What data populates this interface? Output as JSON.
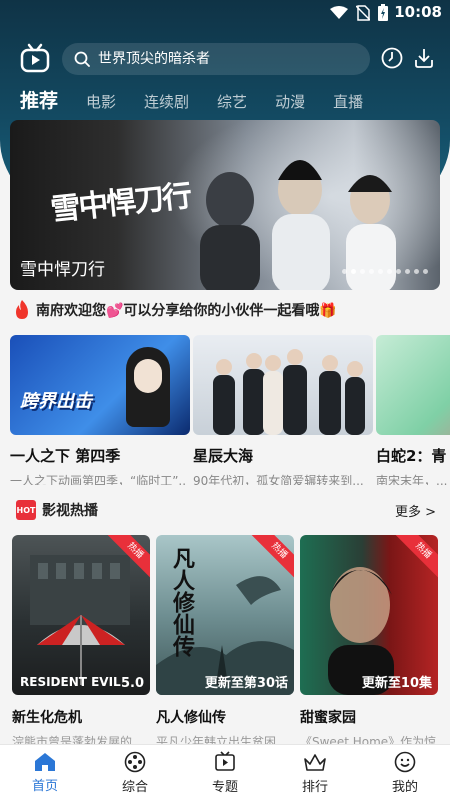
{
  "status": {
    "time": "10:08"
  },
  "search": {
    "placeholder": "世界顶尖的暗杀者"
  },
  "tabs": [
    {
      "label": "推荐",
      "active": true
    },
    {
      "label": "电影"
    },
    {
      "label": "连续剧"
    },
    {
      "label": "综艺"
    },
    {
      "label": "动漫"
    },
    {
      "label": "直播"
    }
  ],
  "banner": {
    "caption": "雪中悍刀行",
    "calligraphy": "雪中悍刀行",
    "dots": 10,
    "active_dot": 1
  },
  "notice": {
    "text": "南府欢迎您💕可以分享给你的小伙伴一起看哦🎁"
  },
  "featured": [
    {
      "title": "一人之下 第四季",
      "desc": "一人之下动画第四季，“临时工”..."
    },
    {
      "title": "星辰大海",
      "desc": "90年代初，孤女简爱辗转来到..."
    },
    {
      "title": "白蛇2：青",
      "desc": "南宋末年，..."
    }
  ],
  "hot_section": {
    "badge": "HOT",
    "label": "影视热播",
    "more": "更多 >"
  },
  "hot_items": [
    {
      "title": "新生化危机",
      "desc": "浣熊市曾是蓬勃发展的...",
      "overlay": "5.0",
      "ribbon": "热播",
      "poster_text": "RESIDENT EVIL"
    },
    {
      "title": "凡人修仙传",
      "desc": "平凡少年韩立出生贫困...",
      "overlay": "更新至第30话",
      "ribbon": "热播",
      "poster_text": "凡人修仙传"
    },
    {
      "title": "甜蜜家园",
      "desc": "《Sweet Home》作为惊...",
      "overlay": "更新至10集",
      "ribbon": "热播",
      "poster_text": ""
    }
  ],
  "nav": [
    {
      "label": "首页",
      "icon": "home-icon",
      "active": true
    },
    {
      "label": "综合",
      "icon": "film-reel-icon"
    },
    {
      "label": "专题",
      "icon": "tv-play-icon"
    },
    {
      "label": "排行",
      "icon": "crown-icon"
    },
    {
      "label": "我的",
      "icon": "smiley-icon"
    }
  ],
  "colors": {
    "header": "#134a62",
    "accent": "#2b77d6",
    "hot": "#e8303a"
  }
}
